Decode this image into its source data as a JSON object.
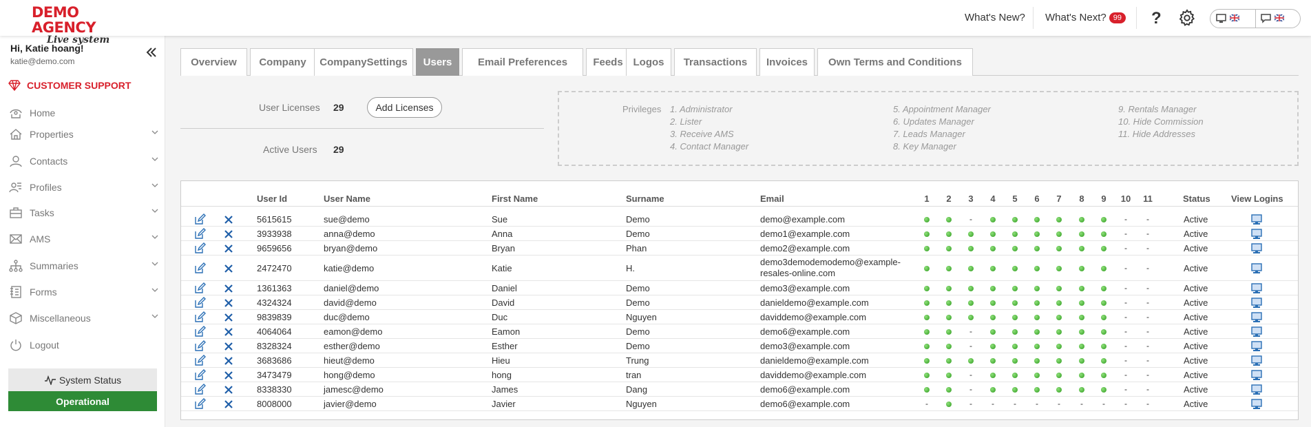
{
  "brand": {
    "line1": "DEMO AGENCY",
    "line2": "Live system"
  },
  "header": {
    "whats_new": "What's New?",
    "whats_next": "What's Next?",
    "whats_next_count": "99",
    "help_icon": "question-icon",
    "settings_icon": "gear-icon"
  },
  "user": {
    "greeting": "Hi, Katie hoang!",
    "email": "katie@demo.com"
  },
  "sidebar": {
    "support": "CUSTOMER SUPPORT",
    "items": [
      {
        "label": "Home",
        "icon": "home-icon",
        "expandable": false
      },
      {
        "label": "Properties",
        "icon": "properties-icon",
        "expandable": true
      },
      {
        "label": "Contacts",
        "icon": "contacts-icon",
        "expandable": true
      },
      {
        "label": "Profiles",
        "icon": "profiles-icon",
        "expandable": true
      },
      {
        "label": "Tasks",
        "icon": "tasks-icon",
        "expandable": true
      },
      {
        "label": "AMS",
        "icon": "mail-icon",
        "expandable": true
      },
      {
        "label": "Summaries",
        "icon": "summaries-icon",
        "expandable": true
      },
      {
        "label": "Forms",
        "icon": "forms-icon",
        "expandable": true
      },
      {
        "label": "Miscellaneous",
        "icon": "box-icon",
        "expandable": true
      },
      {
        "label": "Logout",
        "icon": "power-icon",
        "expandable": false
      }
    ],
    "system_status_label": "System Status",
    "system_status_value": "Operational"
  },
  "tabs": [
    "Overview",
    "Company",
    "CompanySettings",
    "Users",
    "Email Preferences",
    "Feeds",
    "Logos",
    "Transactions",
    "Invoices",
    "Own Terms and Conditions"
  ],
  "active_tab": "Users",
  "licenses": {
    "user_licenses_label": "User Licenses",
    "user_licenses_value": "29",
    "add_button": "Add Licenses",
    "active_users_label": "Active Users",
    "active_users_value": "29"
  },
  "privileges": {
    "label": "Privileges",
    "items": [
      "1. Administrator",
      "2. Lister",
      "3. Receive AMS",
      "4. Contact Manager",
      "5. Appointment Manager",
      "6. Updates Manager",
      "7. Leads Manager",
      "8. Key Manager",
      "9. Rentals Manager",
      "10. Hide Commission",
      "11. Hide Addresses"
    ]
  },
  "table": {
    "columns": {
      "user_id": "User Id",
      "user_name": "User Name",
      "first_name": "First Name",
      "surname": "Surname",
      "email": "Email",
      "status": "Status",
      "view_logins": "View Logins"
    },
    "privilege_columns": [
      "1",
      "2",
      "3",
      "4",
      "5",
      "6",
      "7",
      "8",
      "9",
      "10",
      "11"
    ],
    "rows": [
      {
        "id": "5615615",
        "username": "sue@demo",
        "first": "Sue",
        "surname": "Demo",
        "email": "demo@example.com",
        "status": "Active",
        "privs": [
          1,
          1,
          0,
          1,
          1,
          1,
          1,
          1,
          1,
          0,
          0
        ]
      },
      {
        "id": "3933938",
        "username": "anna@demo",
        "first": "Anna",
        "surname": "Demo",
        "email": "demo1@example.com",
        "status": "Active",
        "privs": [
          1,
          1,
          1,
          1,
          1,
          1,
          1,
          1,
          1,
          0,
          0
        ]
      },
      {
        "id": "9659656",
        "username": "bryan@demo",
        "first": "Bryan",
        "surname": "Phan",
        "email": "demo2@example.com",
        "status": "Active",
        "privs": [
          1,
          1,
          1,
          1,
          1,
          1,
          1,
          1,
          1,
          0,
          0
        ]
      },
      {
        "id": "2472470",
        "username": "katie@demo",
        "first": "Katie",
        "surname": "H.",
        "email": "demo3demodemodemo@example-resales-online.com",
        "status": "Active",
        "privs": [
          1,
          1,
          1,
          1,
          1,
          1,
          1,
          1,
          1,
          0,
          0
        ]
      },
      {
        "id": "1361363",
        "username": "daniel@demo",
        "first": "Daniel",
        "surname": "Demo",
        "email": "demo3@example.com",
        "status": "Active",
        "privs": [
          1,
          1,
          1,
          1,
          1,
          1,
          1,
          1,
          1,
          0,
          0
        ]
      },
      {
        "id": "4324324",
        "username": "david@demo",
        "first": "David",
        "surname": "Demo",
        "email": "danieldemo@example.com",
        "status": "Active",
        "privs": [
          1,
          1,
          1,
          1,
          1,
          1,
          1,
          1,
          1,
          0,
          0
        ]
      },
      {
        "id": "9839839",
        "username": "duc@demo",
        "first": "Duc",
        "surname": "Nguyen",
        "email": "daviddemo@example.com",
        "status": "Active",
        "privs": [
          1,
          1,
          1,
          1,
          1,
          1,
          1,
          1,
          1,
          0,
          0
        ]
      },
      {
        "id": "4064064",
        "username": "eamon@demo",
        "first": "Eamon",
        "surname": "Demo",
        "email": "demo6@example.com",
        "status": "Active",
        "privs": [
          1,
          1,
          0,
          1,
          1,
          1,
          1,
          1,
          1,
          0,
          0
        ]
      },
      {
        "id": "8328324",
        "username": "esther@demo",
        "first": "Esther",
        "surname": "Demo",
        "email": "demo3@example.com",
        "status": "Active",
        "privs": [
          1,
          1,
          0,
          1,
          1,
          1,
          1,
          1,
          1,
          0,
          0
        ]
      },
      {
        "id": "3683686",
        "username": "hieut@demo",
        "first": "Hieu",
        "surname": "Trung",
        "email": "danieldemo@example.com",
        "status": "Active",
        "privs": [
          1,
          1,
          1,
          1,
          1,
          1,
          1,
          1,
          1,
          0,
          0
        ]
      },
      {
        "id": "3473479",
        "username": "hong@demo",
        "first": "hong",
        "surname": "tran",
        "email": "daviddemo@example.com",
        "status": "Active",
        "privs": [
          1,
          1,
          0,
          1,
          1,
          1,
          1,
          1,
          1,
          0,
          0
        ]
      },
      {
        "id": "8338330",
        "username": "jamesc@demo",
        "first": "James",
        "surname": "Dang",
        "email": "demo6@example.com",
        "status": "Active",
        "privs": [
          1,
          1,
          0,
          1,
          1,
          1,
          1,
          1,
          1,
          0,
          0
        ]
      },
      {
        "id": "8008000",
        "username": "javier@demo",
        "first": "Javier",
        "surname": "Nguyen",
        "email": "demo6@example.com",
        "status": "Active",
        "privs": [
          0,
          1,
          0,
          0,
          0,
          0,
          0,
          0,
          0,
          0,
          0
        ]
      }
    ]
  },
  "colors": {
    "brand_red": "#d8202b",
    "operational_green": "#2e8b36",
    "icon_blue": "#2a6fb5"
  }
}
